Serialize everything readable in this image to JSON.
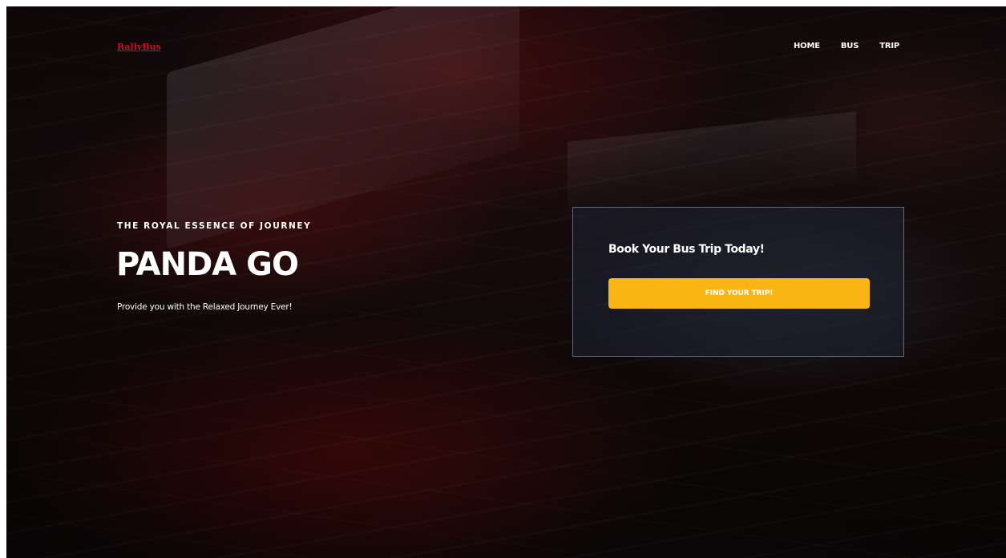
{
  "header": {
    "logo": "RallyBus",
    "nav": [
      {
        "label": "HOME"
      },
      {
        "label": "BUS"
      },
      {
        "label": "TRIP"
      }
    ]
  },
  "hero": {
    "eyebrow": "THE ROYAL ESSENCE OF JOURNEY",
    "title": "PANDA GO",
    "tagline": "Provide you with the Relaxed Journey Ever!"
  },
  "booking": {
    "title": "Book Your Bus Trip Today!",
    "button_label": "FIND YOUR TRIP!"
  },
  "colors": {
    "logo": "#c8101a",
    "cta": "#fbb514",
    "text": "#ffffff"
  }
}
